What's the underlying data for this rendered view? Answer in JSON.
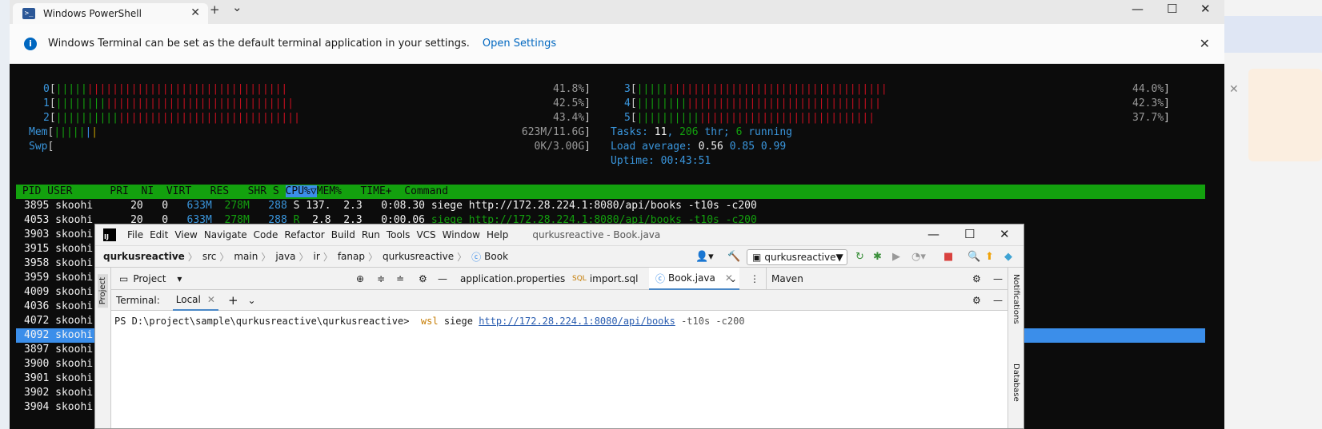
{
  "terminal": {
    "tab_title": "Windows PowerShell",
    "new_tab_glyph": "+",
    "dropdown_glyph": "⌄",
    "infobar": {
      "message": "Windows Terminal can be set as the default terminal application in your settings.",
      "link": "Open Settings"
    }
  },
  "htop": {
    "cpu": [
      {
        "id": "0",
        "green": "|||||",
        "red": "||||||||||||||||||||||||||||||||",
        "pct": "41.8%"
      },
      {
        "id": "1",
        "green": "||||||||",
        "red": "||||||||||||||||||||||||||||||",
        "pct": "42.5%"
      },
      {
        "id": "2",
        "green": "||||||||||",
        "red": "|||||||||||||||||||||||||||||",
        "pct": "43.4%"
      },
      {
        "id": "3",
        "green": "|||||",
        "red": "|||||||||||||||||||||||||||||||||||",
        "pct": "44.0%"
      },
      {
        "id": "4",
        "green": "||||||||",
        "red": "|||||||||||||||||||||||||||||||",
        "pct": "42.3%"
      },
      {
        "id": "5",
        "green": "||||||||||",
        "red": "||||||||||||||||||||||||||||",
        "pct": "37.7%"
      }
    ],
    "mem": {
      "label": "Mem",
      "bar_green": "|||||",
      "bar_blue": "|",
      "bar_yellow": "|",
      "value": "623M/11.6G"
    },
    "swp": {
      "label": "Swp",
      "value": "0K/3.00G"
    },
    "tasks": {
      "label": "Tasks:",
      "tasks": "11",
      "thr": "206",
      "thr_label": "thr;",
      "running": "6",
      "running_label": "running"
    },
    "load": {
      "label": "Load average:",
      "v1": "0.56",
      "v2": "0.85",
      "v3": "0.99"
    },
    "uptime": {
      "label": "Uptime:",
      "value": "00:43:51"
    },
    "header": " PID USER      PRI  NI  VIRT   RES   SHR S ",
    "header_cpu": "CPU%▽",
    "header_rest": "MEM%   TIME+  Command",
    "rows": [
      {
        "pid": "3895",
        "user": "skoohi",
        "pri": "20",
        "ni": "0",
        "virt": "633M",
        "res": "278M",
        "shr": "288",
        "s": "S",
        "cpu": "137.",
        "mem": "2.3",
        "time": "0:08.30",
        "cmd": "siege http://172.28.224.1:8080/api/books -t10s -c200"
      },
      {
        "pid": "4053",
        "user": "skoohi",
        "pri": "20",
        "ni": "0",
        "virt": "633M",
        "res": "278M",
        "shr": "288",
        "s": "R",
        "cpu": "2.8",
        "mem": "2.3",
        "time": "0:00.06",
        "cmd": "siege http://172.28.224.1:8080/api/books -t10s -c200"
      }
    ],
    "partial_rows": [
      {
        "pid": "3903",
        "user": "skoohi"
      },
      {
        "pid": "3915",
        "user": "skoohi"
      },
      {
        "pid": "3958",
        "user": "skoohi"
      },
      {
        "pid": "3959",
        "user": "skoohi"
      },
      {
        "pid": "4009",
        "user": "skoohi"
      },
      {
        "pid": "4036",
        "user": "skoohi"
      },
      {
        "pid": "4072",
        "user": "skoohi"
      },
      {
        "pid": "4092",
        "user": "skoohi"
      },
      {
        "pid": "3897",
        "user": "skoohi"
      },
      {
        "pid": "3900",
        "user": "skoohi"
      },
      {
        "pid": "3901",
        "user": "skoohi"
      },
      {
        "pid": "3902",
        "user": "skoohi"
      },
      {
        "pid": "3904",
        "user": "skoohi"
      }
    ]
  },
  "ide": {
    "menu": [
      "File",
      "Edit",
      "View",
      "Navigate",
      "Code",
      "Refactor",
      "Build",
      "Run",
      "Tools",
      "VCS",
      "Window",
      "Help"
    ],
    "title": "qurkusreactive - Book.java",
    "breadcrumb": [
      "qurkusreactive",
      "src",
      "main",
      "java",
      "ir",
      "fanap",
      "qurkusreactive",
      "Book"
    ],
    "run_config": "qurkusreactive",
    "project_label": "Project",
    "side_project": "Project",
    "editor_tabs": [
      "application.properties",
      "import.sql",
      "Book.java"
    ],
    "maven": "Maven",
    "terminal_label": "Terminal:",
    "terminal_tab": "Local",
    "prompt": "PS D:\\project\\sample\\qurkusreactive\\qurkusreactive>",
    "cmd_wsl": "wsl",
    "cmd_siege": "siege",
    "cmd_url": "http://172.28.224.1:8080/api/books",
    "cmd_args": "-t10s -c200",
    "right_notifications": "Notifications",
    "right_database": "Database"
  }
}
